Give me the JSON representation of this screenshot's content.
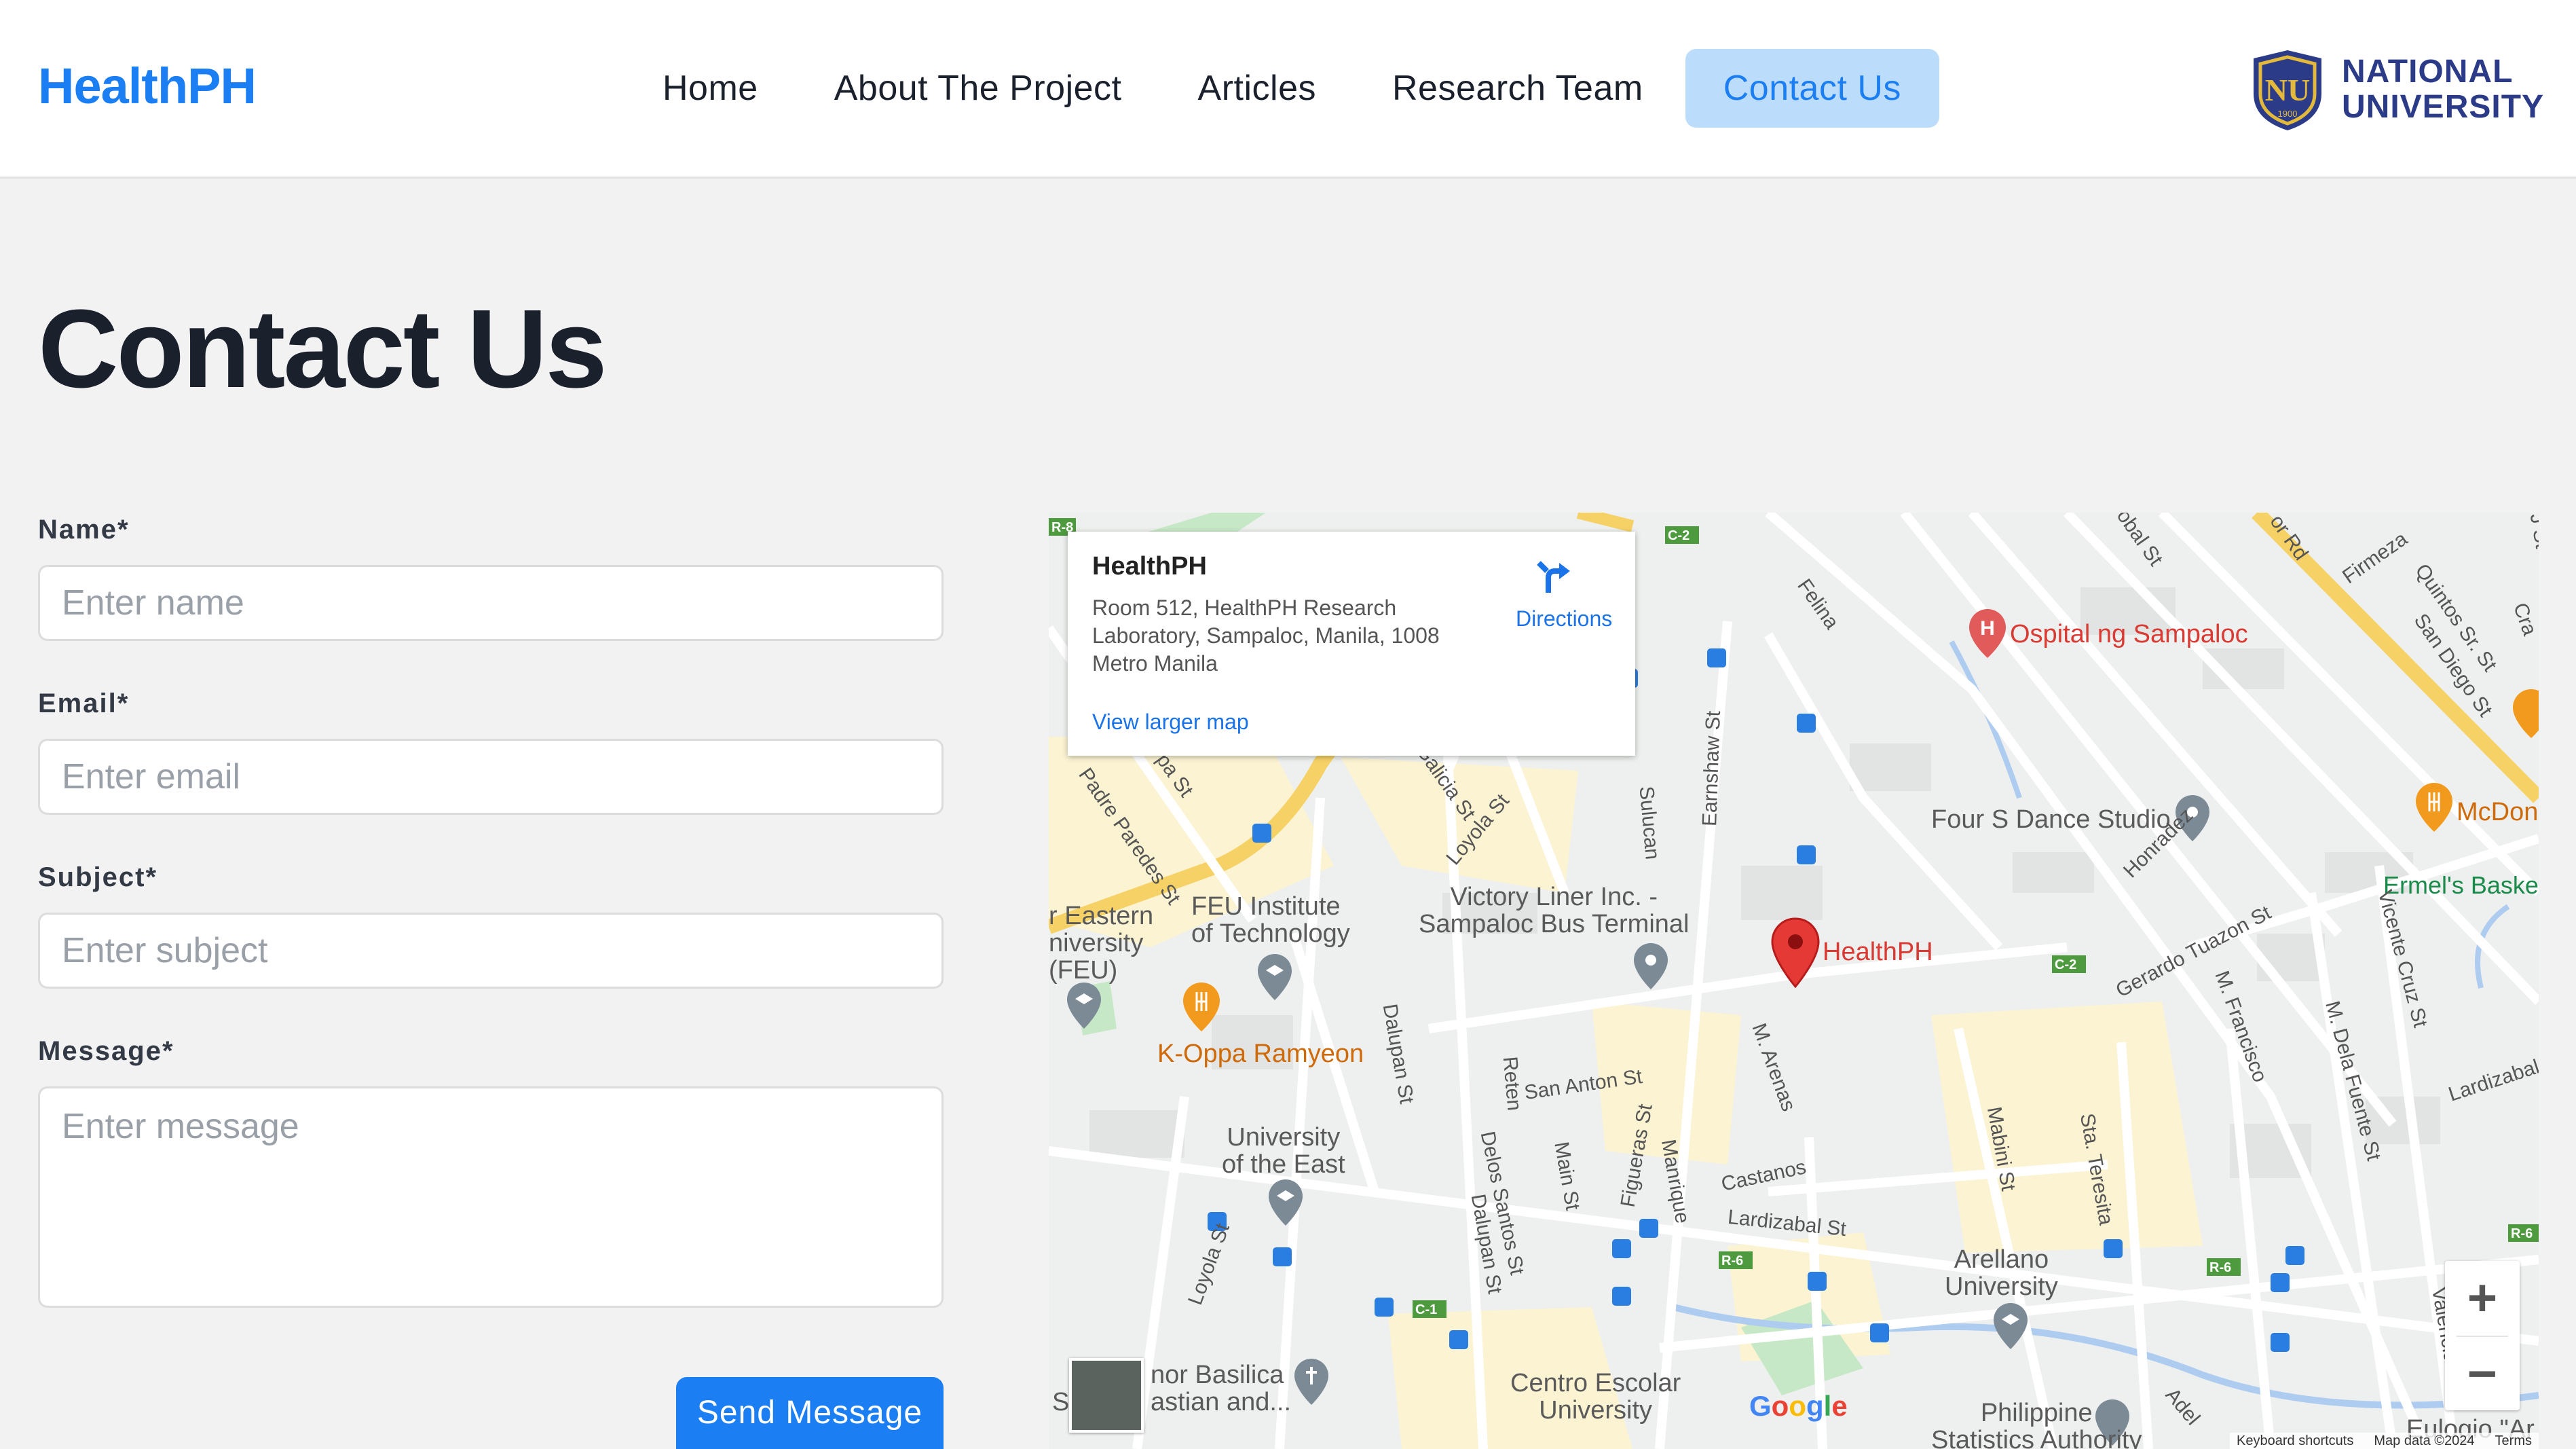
{
  "header": {
    "brand": "HealthPH",
    "nav": [
      {
        "label": "Home"
      },
      {
        "label": "About The Project"
      },
      {
        "label": "Articles"
      },
      {
        "label": "Research Team"
      },
      {
        "label": "Contact Us",
        "active": true
      }
    ],
    "partner_logo_text_line1": "NATIONAL",
    "partner_logo_text_line2": "UNIVERSITY",
    "partner_logo_seal_year": "1900"
  },
  "page": {
    "title": "Contact Us"
  },
  "form": {
    "name_label": "Name*",
    "name_placeholder": "Enter name",
    "email_label": "Email*",
    "email_placeholder": "Enter email",
    "subject_label": "Subject*",
    "subject_placeholder": "Enter subject",
    "message_label": "Message*",
    "message_placeholder": "Enter message",
    "submit_label": "Send Message"
  },
  "map": {
    "infocard": {
      "title": "HealthPH",
      "address": "Room 512, HealthPH Research Laboratory, Sampaloc, Manila, 1008 Metro Manila",
      "directions_label": "Directions",
      "view_larger_label": "View larger map"
    },
    "pins": {
      "main": "HealthPH",
      "hospital": "Ospital ng Sampaloc",
      "restaurant1": "K-Oppa Ramyeon",
      "dance": "Four S Dance Studio",
      "restaurant2": "McDon",
      "basket": "Ermel's Baske",
      "victory_line1": "Victory Liner Inc. -",
      "victory_line2": "Sampaloc Bus Terminal",
      "feu_tech_line1": "FEU Institute",
      "feu_tech_line2": "of Technology",
      "ue_line1": "University",
      "ue_line2": "of the East",
      "feu_line1": "r Eastern",
      "feu_line2": "niversity",
      "feu_line3": "(FEU)",
      "arellano_line1": "Arellano",
      "arellano_line2": "University",
      "centro_line1": "Centro Escolar",
      "centro_line2": "University",
      "basilica_line1": "nor Basilica",
      "basilica_line2": "astian and...",
      "psa_line1": "Philippine",
      "psa_line2": "Statistics Authority",
      "eulogio": "Eulogio \"Ar"
    },
    "streets": [
      "Felina",
      "Firmeza",
      "Quintos Sr. St",
      "San Diego St",
      "Earnshaw St",
      "Sulucan",
      "Loyola St",
      "Galicia St",
      "Padre Paredes St",
      "Honradez",
      "Gerardo Tuazon St",
      "M. Francisco",
      "M. Dela Fuente St",
      "Vicente Cruz St",
      "Lardizabal",
      "San Anton St",
      "Reten",
      "Dalupan St",
      "Delos Santos St",
      "Main St",
      "Figueras St",
      "Manrique",
      "M. Arenas",
      "Castanos",
      "Lardizabal St",
      "Mabini St",
      "Sta. Teresita",
      "Valencia",
      "Adel",
      "Loyola St",
      "Dalupan St",
      "Cra",
      "J St",
      "obal St",
      "or Rd",
      "pa St"
    ],
    "shields": [
      "R-8",
      "C-2",
      "C-2",
      "R-6",
      "R-6",
      "R-6",
      "C-1"
    ],
    "zoom_in": "+",
    "zoom_out": "−",
    "google": "Google",
    "attribution": [
      "Keyboard shortcuts",
      "Map data ©2024",
      "Terms"
    ]
  }
}
